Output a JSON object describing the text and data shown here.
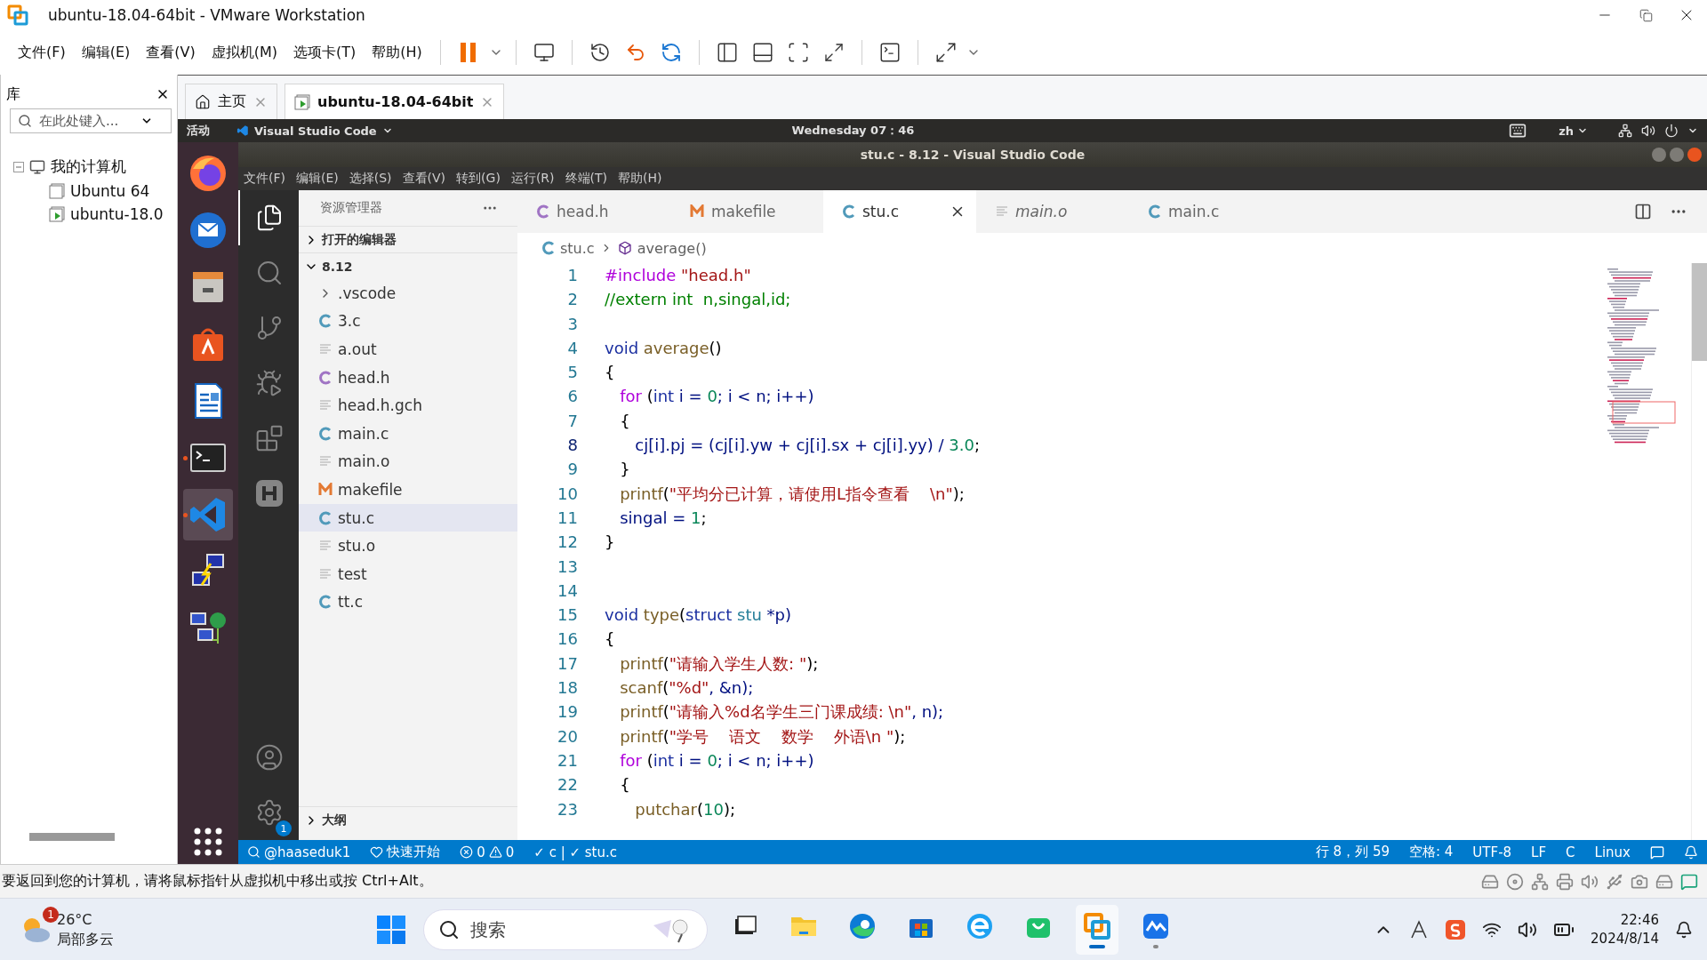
{
  "vmware": {
    "title": "ubuntu-18.04-64bit - VMware Workstation",
    "menus": [
      "文件(F)",
      "编辑(E)",
      "查看(V)",
      "虚拟机(M)",
      "选项卡(T)",
      "帮助(H)"
    ]
  },
  "library": {
    "title": "库",
    "search": {
      "placeholder": "在此处键入..."
    },
    "tree": [
      {
        "label": "我的计算机",
        "expanded": true,
        "children": [
          {
            "label": "Ubuntu 64",
            "kind": "vm"
          },
          {
            "label": "ubuntu-18.0",
            "kind": "vm-running"
          }
        ]
      }
    ]
  },
  "vm_tabs": [
    {
      "label": "主页",
      "kind": "home",
      "selected": false
    },
    {
      "label": "ubuntu-18.04-64bit",
      "kind": "vm",
      "selected": true
    }
  ],
  "ubuntu_bar": {
    "activities": "活动",
    "app_menu": "Visual Studio Code",
    "clock": "Wednesday 07：46",
    "input_method": "zh"
  },
  "dock": [
    {
      "kind": "firefox",
      "running": false,
      "selected": false
    },
    {
      "kind": "mail",
      "running": false,
      "selected": false
    },
    {
      "kind": "files",
      "running": false,
      "selected": false
    },
    {
      "kind": "software",
      "running": false,
      "selected": false
    },
    {
      "kind": "writer",
      "running": false,
      "selected": false
    },
    {
      "kind": "terminal",
      "running": true,
      "selected": false
    },
    {
      "kind": "vscode",
      "running": true,
      "selected": true
    },
    {
      "kind": "remote",
      "running": false,
      "selected": false
    },
    {
      "kind": "network",
      "running": false,
      "selected": false
    }
  ],
  "vscode": {
    "title": "stu.c - 8.12 - Visual Studio Code",
    "menus": [
      "文件(F)",
      "编辑(E)",
      "选择(S)",
      "查看(V)",
      "转到(G)",
      "运行(R)",
      "终端(T)",
      "帮助(H)"
    ],
    "activity_bar": [
      {
        "kind": "files",
        "selected": true
      },
      {
        "kind": "search",
        "selected": false
      },
      {
        "kind": "git",
        "selected": false
      },
      {
        "kind": "debug",
        "selected": false
      },
      {
        "kind": "extensions",
        "selected": false
      },
      {
        "kind": "hex",
        "selected": false
      }
    ],
    "settings_badge": "1",
    "explorer": {
      "title": "资源管理器",
      "open_editors": {
        "label": "打开的编辑器",
        "expanded": false
      },
      "folder": {
        "label": "8.12",
        "expanded": true,
        "children": [
          {
            "label": ".vscode",
            "kind": "folder",
            "selected": false
          },
          {
            "label": "3.c",
            "kind": "c",
            "selected": false
          },
          {
            "label": "a.out",
            "kind": "text",
            "selected": false
          },
          {
            "label": "head.h",
            "kind": "h",
            "selected": false
          },
          {
            "label": "head.h.gch",
            "kind": "text",
            "selected": false
          },
          {
            "label": "main.c",
            "kind": "c",
            "selected": false
          },
          {
            "label": "main.o",
            "kind": "text",
            "selected": false
          },
          {
            "label": "makefile",
            "kind": "make",
            "selected": false
          },
          {
            "label": "stu.c",
            "kind": "c",
            "selected": true
          },
          {
            "label": "stu.o",
            "kind": "text",
            "selected": false
          },
          {
            "label": "test",
            "kind": "text",
            "selected": false
          },
          {
            "label": "tt.c",
            "kind": "c",
            "selected": false
          }
        ]
      },
      "outline": {
        "label": "大纲",
        "expanded": false
      }
    },
    "tabs": [
      {
        "label": "head.h",
        "kind": "h",
        "selected": false,
        "preview": false
      },
      {
        "label": "makefile",
        "kind": "make",
        "selected": false,
        "preview": false
      },
      {
        "label": "stu.c",
        "kind": "c",
        "selected": true,
        "preview": false
      },
      {
        "label": "main.o",
        "kind": "text",
        "selected": false,
        "preview": true
      },
      {
        "label": "main.c",
        "kind": "c",
        "selected": false,
        "preview": false
      }
    ],
    "breadcrumb": [
      {
        "label": "stu.c",
        "kind": "c"
      },
      {
        "label": "average()",
        "kind": "symbol"
      }
    ],
    "lines": [
      {
        "n": "1",
        "current": false,
        "tokens": [
          {
            "text": "#include ",
            "kind": "pp"
          },
          {
            "text": "\"head.h\"",
            "kind": "str"
          }
        ]
      },
      {
        "n": "2",
        "current": false,
        "tokens": [
          {
            "text": "//extern int  n,singal,id;",
            "kind": "cmt"
          }
        ]
      },
      {
        "n": "3",
        "current": false
      },
      {
        "n": "4",
        "current": false,
        "tokens": [
          {
            "text": "void ",
            "kind": "kw"
          },
          {
            "text": "average",
            "kind": "fn"
          },
          {
            "text": "()",
            "kind": "p"
          }
        ]
      },
      {
        "n": "5",
        "current": false,
        "tokens": [
          {
            "text": "{",
            "kind": "p"
          }
        ]
      },
      {
        "n": "6",
        "current": false,
        "tokens": [
          {
            "text": "   for",
            "kind": "ctl"
          },
          {
            "text": " (",
            "kind": "p"
          },
          {
            "text": "int",
            "kind": "kw"
          },
          {
            "text": " i = ",
            "kind": "var"
          },
          {
            "text": "0",
            "kind": "num"
          },
          {
            "text": "; i < n; i++)",
            "kind": "var"
          }
        ]
      },
      {
        "n": "7",
        "current": false,
        "tokens": [
          {
            "text": "   {",
            "kind": "p"
          }
        ]
      },
      {
        "n": "8",
        "current": true,
        "tokens": [
          {
            "text": "      cj[i].pj = (cj[i].yw + cj[i].sx + cj[i].yy) / ",
            "kind": "var"
          },
          {
            "text": "3.0",
            "kind": "num"
          },
          {
            "text": ";",
            "kind": "p"
          }
        ]
      },
      {
        "n": "9",
        "current": false,
        "tokens": [
          {
            "text": "   }",
            "kind": "p"
          }
        ]
      },
      {
        "n": "10",
        "current": false,
        "tokens": [
          {
            "text": "   printf",
            "kind": "fn"
          },
          {
            "text": "(",
            "kind": "p"
          },
          {
            "text": "\"平均分已计算，请使用L指令查看    \\n\"",
            "kind": "str"
          },
          {
            "text": ");",
            "kind": "p"
          }
        ]
      },
      {
        "n": "11",
        "current": false,
        "tokens": [
          {
            "text": "   singal = ",
            "kind": "var"
          },
          {
            "text": "1",
            "kind": "num"
          },
          {
            "text": ";",
            "kind": "p"
          }
        ]
      },
      {
        "n": "12",
        "current": false,
        "tokens": [
          {
            "text": "}",
            "kind": "p"
          }
        ]
      },
      {
        "n": "13",
        "current": false
      },
      {
        "n": "14",
        "current": false
      },
      {
        "n": "15",
        "current": false,
        "tokens": [
          {
            "text": "void ",
            "kind": "kw"
          },
          {
            "text": "type",
            "kind": "fn"
          },
          {
            "text": "(",
            "kind": "p"
          },
          {
            "text": "struct ",
            "kind": "kw"
          },
          {
            "text": "stu ",
            "kind": "type"
          },
          {
            "text": "*p)",
            "kind": "var"
          }
        ]
      },
      {
        "n": "16",
        "current": false,
        "tokens": [
          {
            "text": "{",
            "kind": "p"
          }
        ]
      },
      {
        "n": "17",
        "current": false,
        "tokens": [
          {
            "text": "   printf",
            "kind": "fn"
          },
          {
            "text": "(",
            "kind": "p"
          },
          {
            "text": "\"请输入学生人数: \"",
            "kind": "str"
          },
          {
            "text": ");",
            "kind": "p"
          }
        ]
      },
      {
        "n": "18",
        "current": false,
        "tokens": [
          {
            "text": "   scanf",
            "kind": "fn"
          },
          {
            "text": "(",
            "kind": "p"
          },
          {
            "text": "\"%d\"",
            "kind": "str"
          },
          {
            "text": ", &n);",
            "kind": "var"
          }
        ]
      },
      {
        "n": "19",
        "current": false,
        "tokens": [
          {
            "text": "   printf",
            "kind": "fn"
          },
          {
            "text": "(",
            "kind": "p"
          },
          {
            "text": "\"请输入%d名学生三门课成绩: \\n\"",
            "kind": "str"
          },
          {
            "text": ", n);",
            "kind": "var"
          }
        ]
      },
      {
        "n": "20",
        "current": false,
        "tokens": [
          {
            "text": "   printf",
            "kind": "fn"
          },
          {
            "text": "(",
            "kind": "p"
          },
          {
            "text": "\"学号    语文    数学    外语\\n \"",
            "kind": "str"
          },
          {
            "text": ");",
            "kind": "p"
          }
        ]
      },
      {
        "n": "21",
        "current": false,
        "tokens": [
          {
            "text": "   for",
            "kind": "ctl"
          },
          {
            "text": " (",
            "kind": "p"
          },
          {
            "text": "int",
            "kind": "kw"
          },
          {
            "text": " i = ",
            "kind": "var"
          },
          {
            "text": "0",
            "kind": "num"
          },
          {
            "text": "; i < n; i++)",
            "kind": "var"
          }
        ]
      },
      {
        "n": "22",
        "current": false,
        "tokens": [
          {
            "text": "   {",
            "kind": "p"
          }
        ]
      },
      {
        "n": "23",
        "current": false,
        "tokens": [
          {
            "text": "      putchar",
            "kind": "fn"
          },
          {
            "text": "(",
            "kind": "p"
          },
          {
            "text": "10",
            "kind": "num"
          },
          {
            "text": ");",
            "kind": "p"
          }
        ]
      }
    ],
    "status_bar": {
      "left": [
        {
          "kind": "account",
          "label": "@haaseduk1"
        },
        {
          "kind": "heart",
          "label": "快速开始"
        },
        {
          "kind": "problems",
          "errors": "0",
          "warnings": "0"
        },
        {
          "kind": "plain",
          "label": "✓ c | ✓ stu.c"
        }
      ],
      "right": [
        {
          "kind": "plain",
          "label": "行 8，列 59"
        },
        {
          "kind": "plain",
          "label": "空格: 4"
        },
        {
          "kind": "plain",
          "label": "UTF-8"
        },
        {
          "kind": "plain",
          "label": "LF"
        },
        {
          "kind": "plain",
          "label": "C"
        },
        {
          "kind": "plain",
          "label": "Linux"
        },
        {
          "kind": "feedback"
        },
        {
          "kind": "bell"
        }
      ]
    }
  },
  "vm_status": "要返回到您的计算机，请将鼠标指针从虚拟机中移出或按 Ctrl+Alt。",
  "taskbar": {
    "weather": {
      "temperature": "26°C",
      "condition": "局部多云",
      "badge": "1"
    },
    "search": {
      "placeholder": "搜索"
    },
    "apps": [
      {
        "kind": "task-view",
        "running": false,
        "selected": false
      },
      {
        "kind": "folder",
        "running": false,
        "selected": false
      },
      {
        "kind": "edge",
        "running": false,
        "selected": false
      },
      {
        "kind": "store",
        "running": false,
        "selected": false
      },
      {
        "kind": "browser",
        "running": false,
        "selected": false
      },
      {
        "kind": "bag",
        "running": false,
        "selected": false
      },
      {
        "kind": "vmware",
        "running": true,
        "selected": true
      },
      {
        "kind": "cloud",
        "running": true,
        "selected": false
      }
    ],
    "time": "22:46",
    "date": "2024/8/14"
  }
}
